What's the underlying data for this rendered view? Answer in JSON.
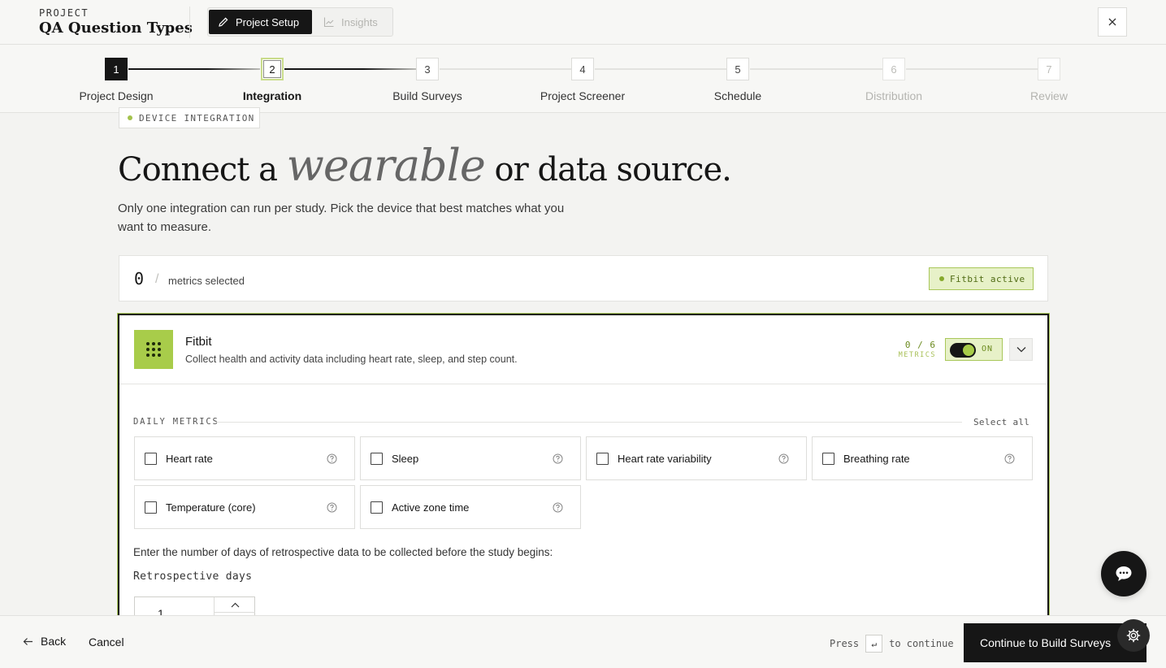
{
  "header": {
    "project_label": "PROJECT",
    "project_title": "QA Question Types",
    "tabs": [
      {
        "label": "Project Setup",
        "icon": "pencil-icon"
      },
      {
        "label": "Insights",
        "icon": "chart-line-icon"
      }
    ],
    "close_icon": "close-icon"
  },
  "stepper": {
    "steps": [
      {
        "num": "1",
        "label": "Project Design",
        "state": "done"
      },
      {
        "num": "2",
        "label": "Integration",
        "state": "current"
      },
      {
        "num": "3",
        "label": "Build Surveys",
        "state": "upcoming"
      },
      {
        "num": "4",
        "label": "Project Screener",
        "state": "upcoming"
      },
      {
        "num": "5",
        "label": "Schedule",
        "state": "upcoming"
      },
      {
        "num": "6",
        "label": "Distribution",
        "state": "disabled"
      },
      {
        "num": "7",
        "label": "Review",
        "state": "disabled"
      }
    ]
  },
  "main": {
    "tag": "DEVICE INTEGRATION",
    "headline_pre": "Connect a ",
    "headline_italic": "wearable",
    "headline_post": " or data source.",
    "subtext": "Only one integration can run per study. Pick the device that best matches what you want to measure.",
    "metrics_bar": {
      "count": "0",
      "slash": "/",
      "text": "metrics selected",
      "badge": "Fitbit active"
    },
    "card": {
      "title": "Fitbit",
      "description": "Collect health and activity data including heart rate, sleep, and step count.",
      "count": "0 / 6",
      "count_label": "METRICS",
      "toggle_label": "ON",
      "toggle_on": true,
      "section_label": "DAILY METRICS",
      "select_all": "Select all",
      "metrics": [
        {
          "label": "Heart rate",
          "checked": false
        },
        {
          "label": "Sleep",
          "checked": false
        },
        {
          "label": "Heart rate variability",
          "checked": false
        },
        {
          "label": "Breathing rate",
          "checked": false
        },
        {
          "label": "Temperature (core)",
          "checked": false
        },
        {
          "label": "Active zone time",
          "checked": false
        }
      ],
      "retro_text": "Enter the number of days of retrospective data to be collected before the study begins:",
      "retro_label": "Retrospective days",
      "retro_value": "1"
    }
  },
  "footer": {
    "back": "Back",
    "cancel": "Cancel",
    "press": "Press",
    "key": "↵",
    "to_continue": "to continue",
    "continue": "Continue to Build Surveys"
  },
  "colors": {
    "accent_green": "#a8cc4a",
    "dark": "#161616",
    "background": "#f3f3f1"
  }
}
